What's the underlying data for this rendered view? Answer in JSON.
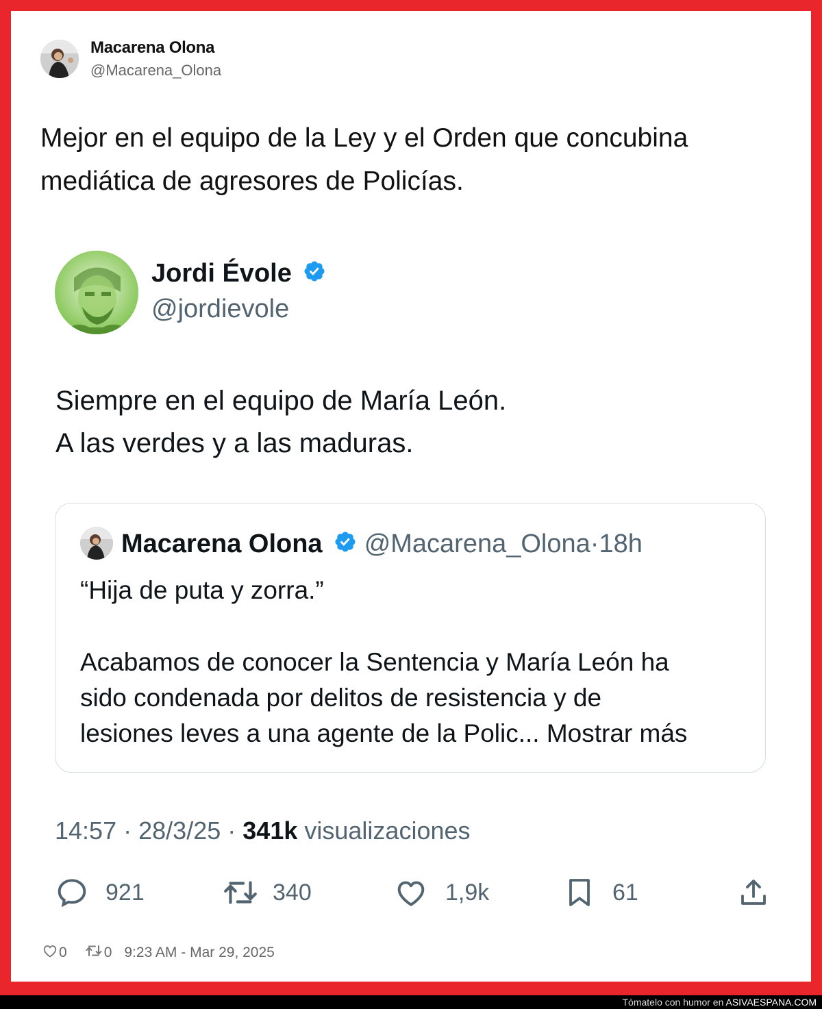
{
  "outer_tweet": {
    "name": "Macarena Olona",
    "handle": "@Macarena_Olona",
    "text_line1": "Mejor en el equipo de la Ley y el Orden que concubina",
    "text_line2": "mediática de agresores de Policías."
  },
  "tweet": {
    "name": "Jordi Évole",
    "handle": "@jordievole",
    "text_line1": "Siempre en el equipo de María León.",
    "text_line2": "A las verdes y a las maduras.",
    "quote": {
      "name": "Macarena Olona",
      "handle": "@Macarena_Olona",
      "separator": "·",
      "age": "18h",
      "line1": "“Hija de puta y zorra.”",
      "line2": "Acabamos de conocer la Sentencia y María León ha",
      "line3": "sido condenada por delitos de resistencia y de",
      "line4": "lesiones leves a una agente de la Polic...",
      "show_more": "Mostrar más"
    },
    "time": "14:57",
    "date": "28/3/25",
    "views": "341k",
    "views_label": "visualizaciones",
    "dot": "·",
    "stats": {
      "replies": "921",
      "retweets": "340",
      "likes": "1,9k",
      "bookmarks": "61"
    }
  },
  "footer": {
    "likes": "0",
    "retweets": "0",
    "timestamp": "9:23 AM - Mar 29, 2025"
  },
  "credit": {
    "text": "Tómatelo con humor en",
    "site": "ASIVAESPANA.COM"
  },
  "colors": {
    "frame": "#e8262b",
    "verified": "#1d9bf0",
    "secondary_text": "#536471"
  }
}
